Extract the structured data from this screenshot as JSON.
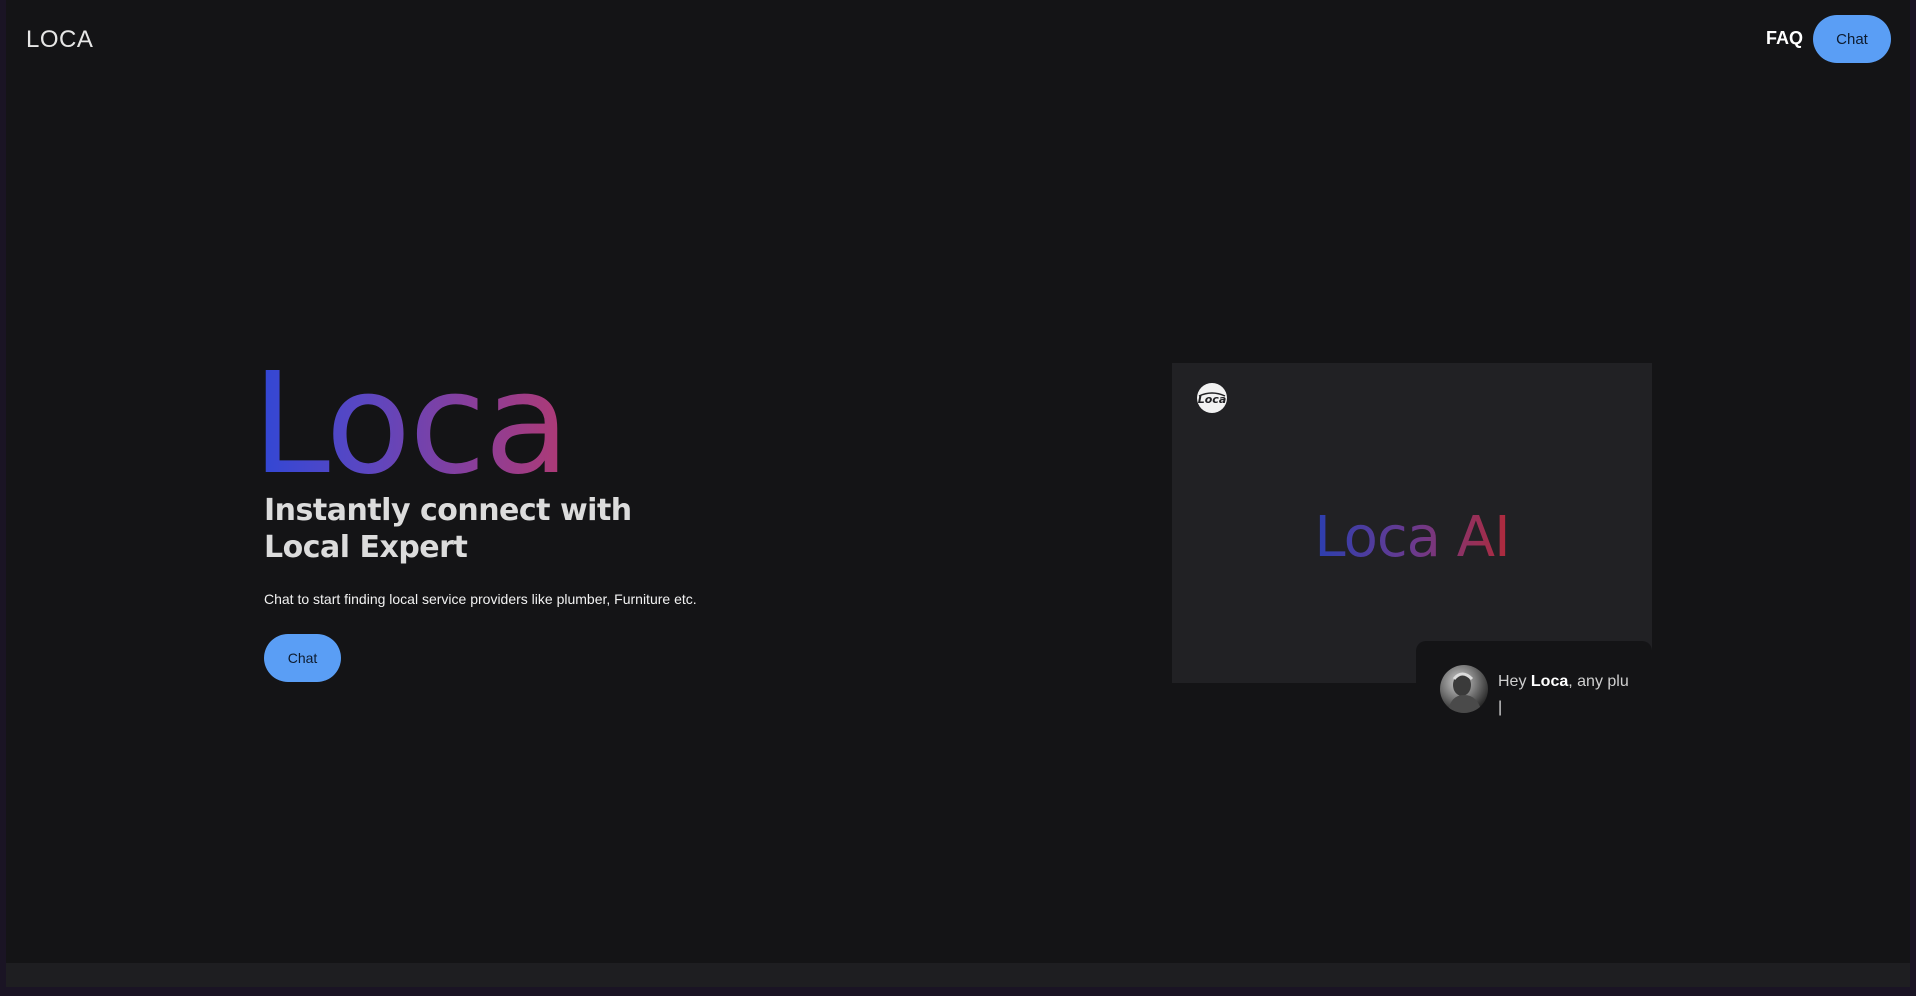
{
  "header": {
    "logo": "LOCA",
    "nav": {
      "faq_label": "FAQ",
      "chat_label": "Chat"
    }
  },
  "hero": {
    "brand_word": "Loca",
    "headline_line1": "Instantly connect with",
    "headline_line2": "Local Expert",
    "subtitle": "Chat to start finding local service providers like plumber, Furniture etc.",
    "cta_label": "Chat"
  },
  "preview": {
    "logo_text": "Loca",
    "title": "Loca AI",
    "chat": {
      "text_prefix": "Hey ",
      "text_bold": "Loca",
      "text_suffix": ", any plu",
      "cursor": "|"
    }
  },
  "colors": {
    "accent": "#5a9ef5",
    "background": "#141416",
    "panel": "#212124"
  }
}
